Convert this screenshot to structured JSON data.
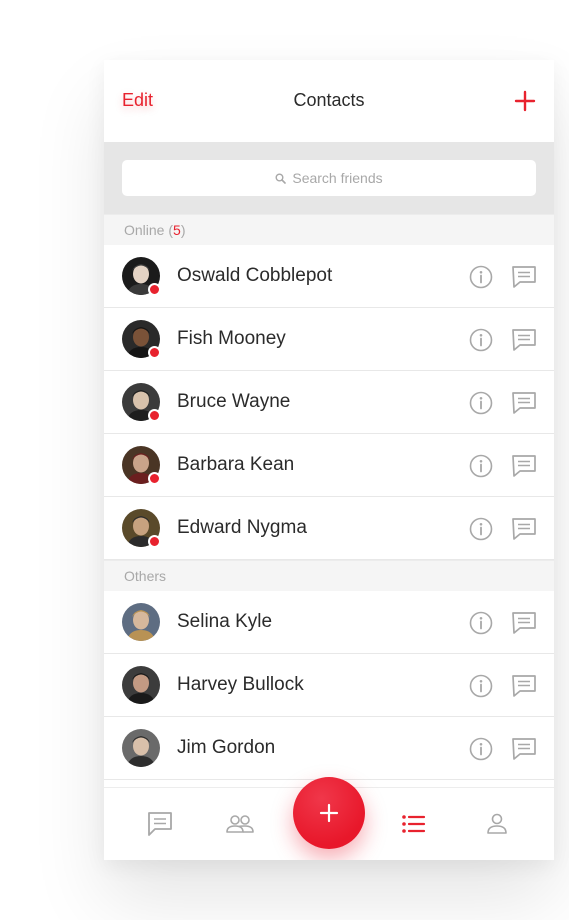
{
  "header": {
    "edit_label": "Edit",
    "title": "Contacts",
    "add_icon": "plus-icon"
  },
  "search": {
    "placeholder": "Search friends",
    "icon": "search-icon"
  },
  "online_section": {
    "label": "Online",
    "open": "(",
    "count": "5",
    "close": ")"
  },
  "others_section": {
    "label": "Others"
  },
  "online_contacts": [
    {
      "name": "Oswald Cobblepot",
      "online": true
    },
    {
      "name": "Fish Mooney",
      "online": true
    },
    {
      "name": "Bruce Wayne",
      "online": true
    },
    {
      "name": "Barbara Kean",
      "online": true
    },
    {
      "name": "Edward Nygma",
      "online": true
    }
  ],
  "other_contacts": [
    {
      "name": "Selina Kyle",
      "online": false
    },
    {
      "name": "Harvey Bullock",
      "online": false
    },
    {
      "name": "Jim Gordon",
      "online": false
    }
  ],
  "tabs": [
    {
      "icon": "chat-icon",
      "active": false
    },
    {
      "icon": "people-icon",
      "active": false
    },
    {
      "icon": "plus-icon",
      "active": false
    },
    {
      "icon": "list-icon",
      "active": true
    },
    {
      "icon": "profile-icon",
      "active": false
    }
  ],
  "colors": {
    "accent": "#e8222e",
    "muted": "#a8a8a8",
    "text": "#2b2b2b",
    "search_bg": "#e6e6e6",
    "section_bg": "#f5f5f5"
  }
}
